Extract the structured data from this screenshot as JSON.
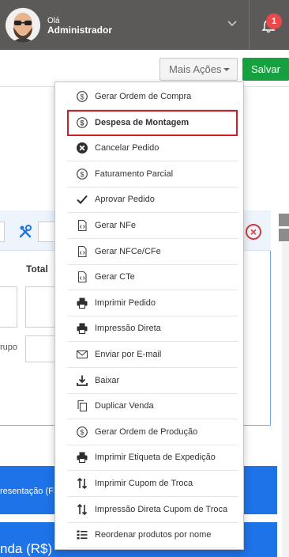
{
  "header": {
    "greeting": "Olá",
    "username": "Administrador",
    "notification_count": "1",
    "icons": [
      "avatar",
      "chevron-down-icon",
      "bell-icon"
    ]
  },
  "toolbar": {
    "more_actions_label": "Mais Ações",
    "save_label": "Salvar"
  },
  "background": {
    "total_label": "Total",
    "grupo_label": "rupo",
    "tab_text": "resentação (F",
    "section_text": "nda (R$)"
  },
  "dropdown": {
    "items": [
      {
        "label": "Gerar Ordem de Compra",
        "icon": "dollar-circle-icon"
      },
      {
        "label": "Despesa de Montagem",
        "icon": "dollar-circle-icon"
      },
      {
        "label": "Cancelar Pedido",
        "icon": "x-circle-icon"
      },
      {
        "label": "Faturamento Parcial",
        "icon": "dollar-circle-icon"
      },
      {
        "label": "Aprovar Pedido",
        "icon": "check-icon"
      },
      {
        "label": "Gerar NFe",
        "icon": "code-file-icon"
      },
      {
        "label": "Gerar NFCe/CFe",
        "icon": "code-file-icon"
      },
      {
        "label": "Gerar CTe",
        "icon": "code-file-icon"
      },
      {
        "label": "Imprimir Pedido",
        "icon": "printer-icon"
      },
      {
        "label": "Impressão Direta",
        "icon": "printer-icon"
      },
      {
        "label": "Enviar por E-mail",
        "icon": "envelope-icon"
      },
      {
        "label": "Baixar",
        "icon": "download-icon"
      },
      {
        "label": "Duplicar Venda",
        "icon": "copy-icon"
      },
      {
        "label": "Gerar Ordem de Produção",
        "icon": "dollar-circle-icon"
      },
      {
        "label": "Imprimir Etiqueta de Expedição",
        "icon": "printer-icon"
      },
      {
        "label": "Imprimir Cupom de Troca",
        "icon": "swap-vertical-icon"
      },
      {
        "label": "Impressão Direta Cupom de Troca",
        "icon": "swap-vertical-icon"
      },
      {
        "label": "Reordenar produtos por nome",
        "icon": "list-icon"
      }
    ],
    "highlighted_index": 1
  },
  "colors": {
    "header_bg": "#5b5a58",
    "save_green": "#17a03f",
    "highlight_red": "#cc1f26",
    "accent_blue": "#1e73e8",
    "badge_red": "#e84a4a"
  }
}
